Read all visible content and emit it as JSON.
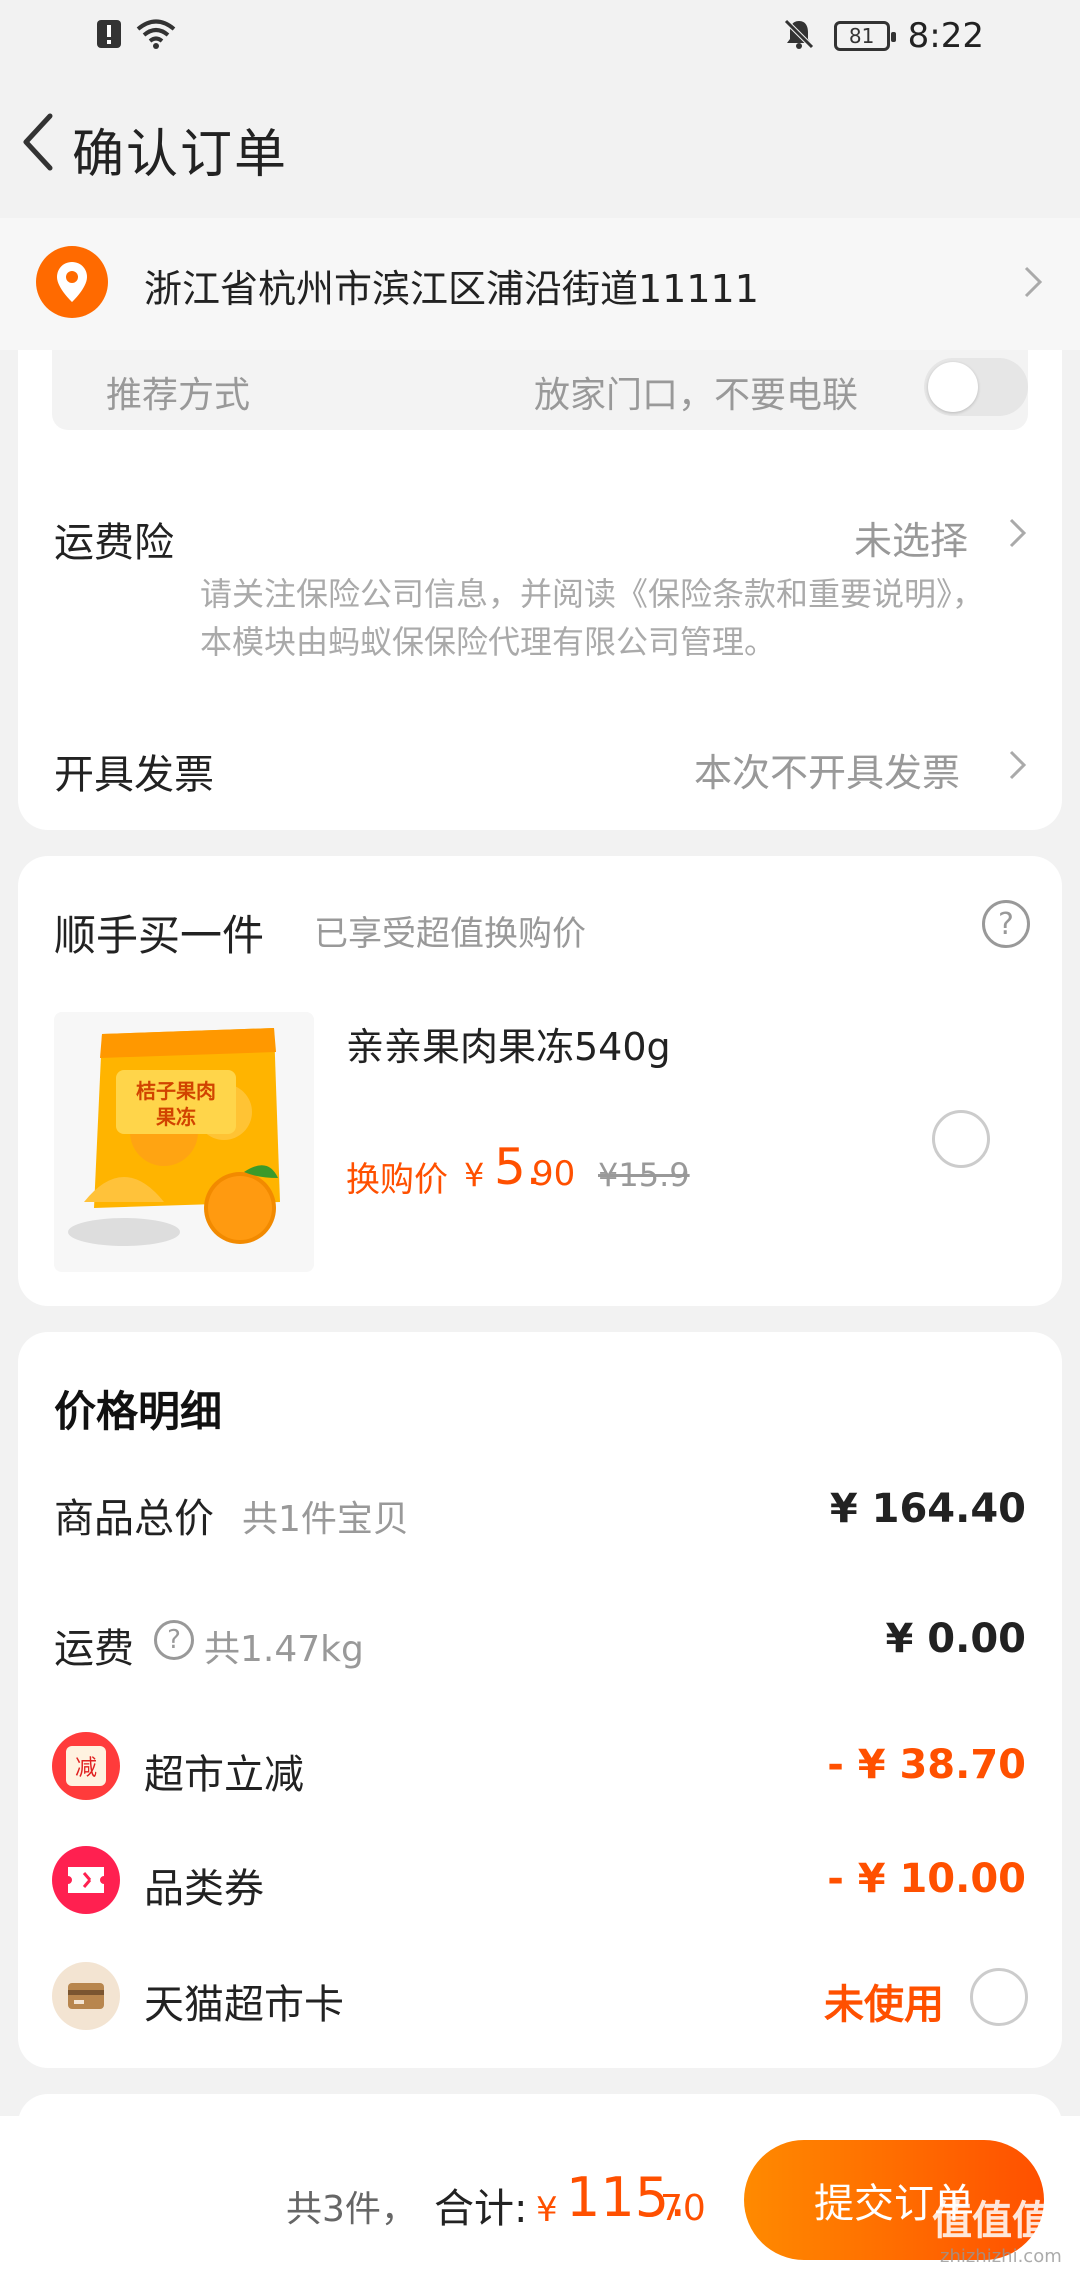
{
  "status_bar": {
    "time": "8:22",
    "battery": "81"
  },
  "header": {
    "title": "确认订单"
  },
  "address": {
    "text": "浙江省杭州市滨江区浦沿街道11111"
  },
  "delivery": {
    "label": "推荐方式",
    "value": "放家门口，不要电联"
  },
  "shipping_insurance": {
    "label": "运费险",
    "value": "未选择",
    "note": "请关注保险公司信息，并阅读《保险条款和重要说明》，本模块由蚂蚁保保险代理有限公司管理。"
  },
  "invoice": {
    "label": "开具发票",
    "value": "本次不开具发票"
  },
  "add_on": {
    "title": "顺手买一件",
    "subtitle": "已享受超值换购价",
    "product": {
      "name": "亲亲果肉果冻540g",
      "price_label": "换购价",
      "currency": "¥",
      "price_int": "5.",
      "price_dec": "90",
      "original_price": "¥15.9",
      "package_text": "桔子果肉果冻"
    }
  },
  "price_detail": {
    "title": "价格明细",
    "rows": [
      {
        "label": "商品总价",
        "sub": "共1件宝贝",
        "amount": "¥ 164.40"
      },
      {
        "label": "运费",
        "sub": "共1.47kg",
        "amount": "¥ 0.00"
      },
      {
        "label": "超市立减",
        "amount": "- ¥ 38.70",
        "badge_text": "减"
      },
      {
        "label": "品类券",
        "amount": "- ¥ 10.00"
      },
      {
        "label": "天猫超市卡",
        "amount": "未使用"
      }
    ]
  },
  "bottom_bar": {
    "count": "共3件，",
    "total_label": "合计:",
    "currency": "¥",
    "total_int": "115.",
    "total_dec": "70",
    "submit_label": "提交订单"
  },
  "watermark": {
    "brand": "值值值",
    "url": "zhizhizhi.com"
  },
  "colors": {
    "accent": "#ff5000",
    "accent_light": "#ff8a00",
    "background": "#f2f2f2"
  }
}
